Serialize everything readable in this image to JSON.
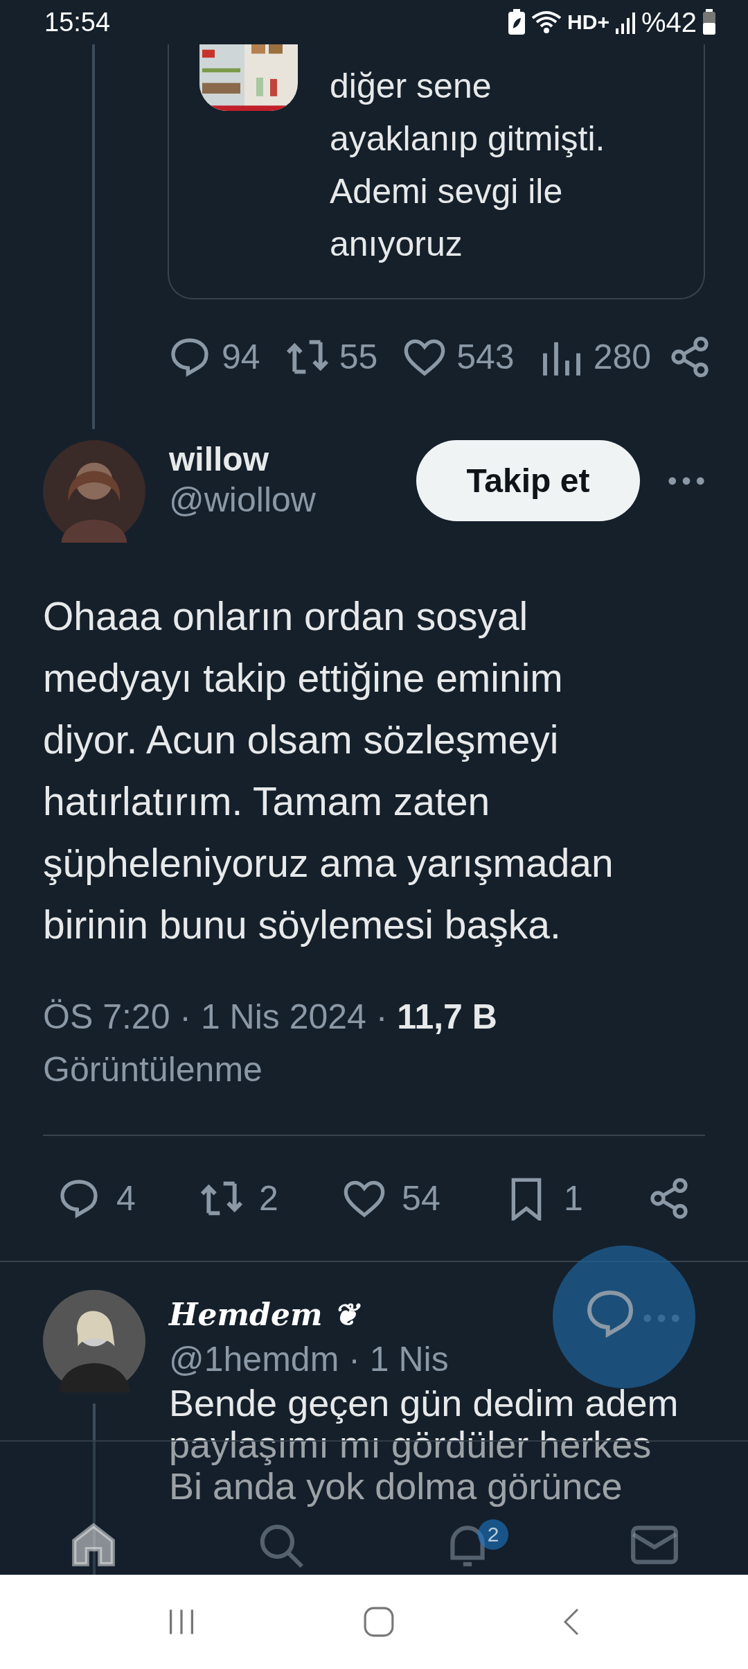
{
  "status_bar": {
    "time": "15:54",
    "network": "HD+",
    "battery": "%42"
  },
  "quoted_tweet": {
    "lines": [
      "diğer sene",
      "ayaklanıp gitmişti.",
      "Ademi sevgi ile",
      "anıyoruz"
    ],
    "stats": {
      "replies": "94",
      "retweets": "55",
      "likes": "543",
      "views": "280"
    }
  },
  "tweet": {
    "name": "willow",
    "handle": "@wiollow",
    "follow": "Takip et",
    "following": false,
    "lines": [
      "Ohaaa onların ordan sosyal",
      "medyayı takip ettiğine eminim",
      "diyor. Acun olsam sözleşmeyi",
      "hatırlatırım. Tamam zaten",
      "şüpheleniyoruz ama yarışmadan",
      "birinin bunu söylemesi başka."
    ],
    "meta": "ÖS 7:20 · 1 Nis 2024 · ",
    "views": "11,7 B",
    "views_label": "Görüntülenme",
    "stats": {
      "replies": "4",
      "retweets": "2",
      "likes": "54",
      "bookmarks": "1"
    }
  },
  "reply": {
    "name": "Hemdem ❦",
    "handle": "@1hemdm · 1 Nis",
    "lines": [
      "Bende geçen gün dedim adem",
      "paylaşımı mı gördüler herkes",
      "Bi anda yok dolma görünce"
    ]
  },
  "bottom_nav": {
    "items": [
      {
        "kind": "home",
        "selected": true
      },
      {
        "kind": "search",
        "selected": false
      },
      {
        "kind": "notifications",
        "selected": false,
        "badge": "2"
      },
      {
        "kind": "messages",
        "selected": false
      }
    ]
  }
}
